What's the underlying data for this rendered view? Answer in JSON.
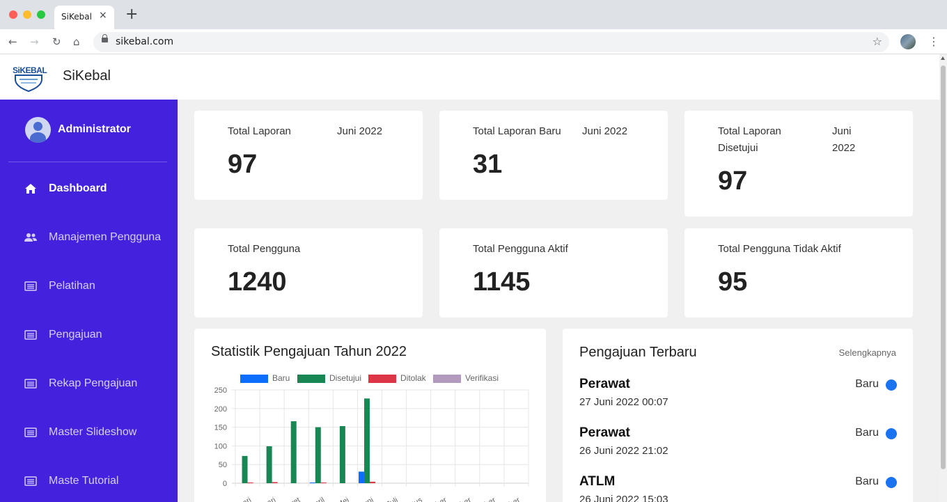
{
  "browser": {
    "tab_title": "SiKebal",
    "tab_close": "×",
    "new_tab": "+",
    "url": "sikebal.com"
  },
  "app": {
    "logo_text": "SiKEBAL",
    "name": "SiKebal"
  },
  "sidebar": {
    "user_name": "Administrator",
    "items": [
      {
        "label": "Dashboard",
        "icon": "home-icon",
        "active": true
      },
      {
        "label": "Manajemen Pengguna",
        "icon": "users-icon",
        "active": false
      },
      {
        "label": "Pelatihan",
        "icon": "list-icon",
        "active": false
      },
      {
        "label": "Pengajuan",
        "icon": "list-icon",
        "active": false
      },
      {
        "label": "Rekap Pengajuan",
        "icon": "list-icon",
        "active": false
      },
      {
        "label": "Master Slideshow",
        "icon": "list-icon",
        "active": false
      },
      {
        "label": "Maste Tutorial",
        "icon": "list-icon",
        "active": false
      }
    ]
  },
  "stats": [
    {
      "label": "Total Laporan",
      "period": "Juni 2022",
      "value": "97"
    },
    {
      "label": "Total Laporan Baru",
      "period": "Juni 2022",
      "value": "31"
    },
    {
      "label_line1": "Total Laporan",
      "label_line2": "Disetujui",
      "period_line1": "Juni",
      "period_line2": "2022",
      "value": "97"
    },
    {
      "label": "Total Pengguna",
      "value": "1240"
    },
    {
      "label": "Total Pengguna Aktif",
      "value": "1145"
    },
    {
      "label": "Total Pengguna Tidak Aktif",
      "value": "95"
    }
  ],
  "chart": {
    "title": "Statistik Pengajuan Tahun 2022"
  },
  "chart_data": {
    "type": "bar",
    "categories": [
      "Januari",
      "Februari",
      "Maret",
      "April",
      "Mei",
      "Juni",
      "Juli",
      "Agustus",
      "September",
      "Oktober",
      "November",
      "Desember"
    ],
    "visible_tick_labels": [
      "uari",
      "uari",
      "aret",
      "April",
      "Mei",
      "Juni",
      "Juli",
      "tus",
      "ber",
      "ber",
      "ber",
      "ber"
    ],
    "series": [
      {
        "name": "Baru",
        "color": "#0d6efd",
        "values": [
          0,
          0,
          0,
          1,
          0,
          31,
          0,
          0,
          0,
          0,
          0,
          0
        ]
      },
      {
        "name": "Disetujui",
        "color": "#198754",
        "values": [
          73,
          99,
          166,
          150,
          153,
          227,
          0,
          0,
          0,
          0,
          0,
          0
        ]
      },
      {
        "name": "Ditolak",
        "color": "#dc3545",
        "values": [
          2,
          3,
          0,
          1,
          0,
          4,
          0,
          0,
          0,
          0,
          0,
          0
        ]
      },
      {
        "name": "Verifikasi",
        "color": "#b39bbd",
        "values": [
          0,
          0,
          0,
          0,
          0,
          0,
          0,
          0,
          0,
          0,
          0,
          0
        ]
      }
    ],
    "y_ticks": [
      0,
      50,
      100,
      150,
      200,
      250
    ],
    "ylim": [
      0,
      250
    ],
    "grid": true,
    "legend": "top"
  },
  "latest": {
    "title": "Pengajuan Terbaru",
    "see_all": "Selengkapnya",
    "items": [
      {
        "name": "Perawat",
        "date": "27 Juni 2022 00:07",
        "status": "Baru"
      },
      {
        "name": "Perawat",
        "date": "26 Juni 2022 21:02",
        "status": "Baru"
      },
      {
        "name": "ATLM",
        "date": "26 Juni 2022 15:03",
        "status": "Baru"
      }
    ]
  },
  "colors": {
    "sidebar": "#4422dd",
    "status_dot": "#1a73f0"
  }
}
